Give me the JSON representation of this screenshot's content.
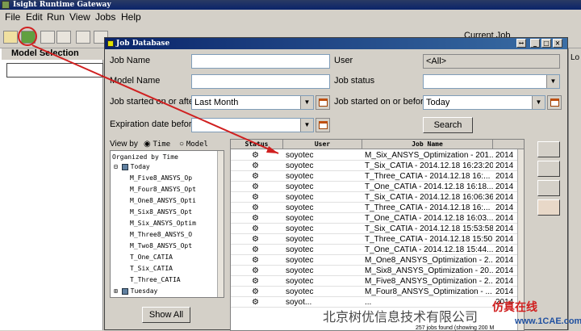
{
  "app": {
    "title": "Isight Runtime Gateway"
  },
  "menu": [
    "File",
    "Edit",
    "Run",
    "View",
    "Jobs",
    "Help"
  ],
  "toolbar": {
    "current_job_label": "Current Job"
  },
  "left_panel": {
    "title": "Model Selection"
  },
  "right_panel": {
    "label": "Lo"
  },
  "dialog": {
    "title": "Job Database",
    "window_buttons": [
      "↔",
      "_",
      "□",
      "×"
    ],
    "job_name_label": "Job Name",
    "job_name_value": "",
    "model_name_label": "Model Name",
    "model_name_value": "",
    "started_after_label": "Job started on or after",
    "started_after_value": "Last Month",
    "expiration_label": "Expiration date before",
    "expiration_value": "",
    "user_label": "User",
    "user_value": "<All>",
    "status_label": "Job status",
    "status_value": "",
    "started_before_label": "Job started on or before",
    "started_before_value": "Today",
    "search_button": "Search",
    "view_by_label": "View by",
    "view_time": "Time",
    "view_model": "Model",
    "show_all_button": "Show All",
    "footer": "257 jobs found (showing 200 M"
  },
  "tree": {
    "root": "Organized by Time",
    "today": "Today",
    "items": [
      "M_Five8_ANSYS_Op",
      "M_Four8_ANSYS_Opt",
      "M_One8_ANSYS_Opti",
      "M_Six8_ANSYS_Opt",
      "M_Six_ANSYS_Optim",
      "M_Three8_ANSYS_O",
      "M_Two8_ANSYS_Opt",
      "T_One_CATIA",
      "T_Six_CATIA",
      "T_Three_CATIA"
    ],
    "tuesday": "Tuesday"
  },
  "table": {
    "headers": [
      "Status",
      "User",
      "Job Name",
      ""
    ],
    "rows": [
      [
        "soyotec",
        "M_Six_ANSYS_Optimization - 201...",
        "2014"
      ],
      [
        "soyotec",
        "T_Six_CATIA - 2014.12.18 16:23:20",
        "2014"
      ],
      [
        "soyotec",
        "T_Three_CATIA - 2014.12.18 16:...",
        "2014"
      ],
      [
        "soyotec",
        "T_One_CATIA - 2014.12.18 16:18...",
        "2014"
      ],
      [
        "soyotec",
        "T_Six_CATIA - 2014.12.18 16:06:36",
        "2014"
      ],
      [
        "soyotec",
        "T_Three_CATIA - 2014.12.18 16:...",
        "2014"
      ],
      [
        "soyotec",
        "T_One_CATIA - 2014.12.18 16:03...",
        "2014"
      ],
      [
        "soyotec",
        "T_Six_CATIA - 2014.12.18 15:53:58",
        "2014"
      ],
      [
        "soyotec",
        "T_Three_CATIA - 2014.12.18 15:50...",
        "2014"
      ],
      [
        "soyotec",
        "T_One_CATIA - 2014.12.18 15:44...",
        "2014"
      ],
      [
        "soyotec",
        "M_One8_ANSYS_Optimization - 2...",
        "2014"
      ],
      [
        "soyotec",
        "M_Six8_ANSYS_Optimization - 20...",
        "2014"
      ],
      [
        "soyotec",
        "M_Five8_ANSYS_Optimization - 2...",
        "2014"
      ],
      [
        "soyotec",
        "M_Four8_ANSYS_Optimization - ...",
        "2014"
      ],
      [
        "soyot...",
        "...",
        "2014"
      ]
    ]
  },
  "watermark": {
    "text": "北京树优信息技术有限公司",
    "brand": "仿真在线",
    "site": "www.1CAE.com"
  },
  "icons": {
    "status": "job-status-icon",
    "calendar": "calendar-icon",
    "dropdown": "chevron-down-icon"
  }
}
